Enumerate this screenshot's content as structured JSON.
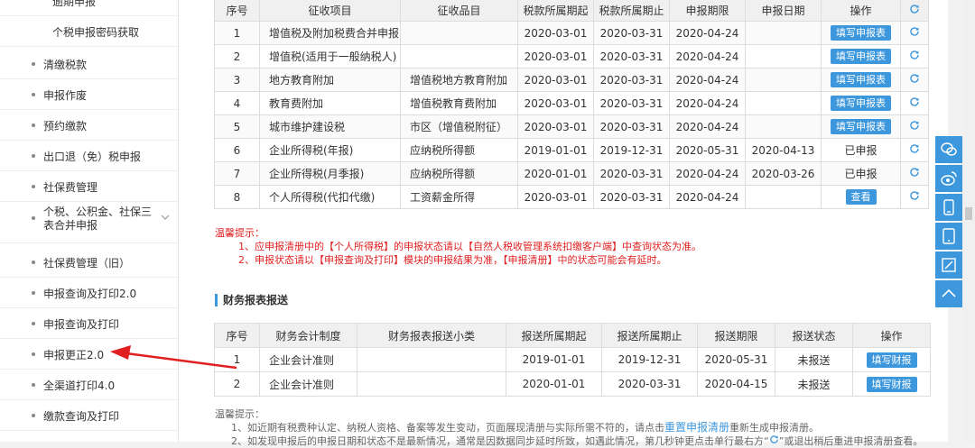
{
  "sidebar": {
    "items": [
      {
        "label": "逾期申报"
      },
      {
        "label": "个税申报密码获取"
      },
      {
        "label": "清缴税款"
      },
      {
        "label": "申报作废"
      },
      {
        "label": "预约缴款"
      },
      {
        "label": "出口退（免）税申报"
      },
      {
        "label": "社保费管理"
      },
      {
        "label": "个税、公积金、社保三表合并申报"
      },
      {
        "label": "社保费管理（旧）"
      },
      {
        "label": "申报查询及打印2.0"
      },
      {
        "label": "申报查询及打印"
      },
      {
        "label": "申报更正2.0"
      },
      {
        "label": "全渠道打印4.0"
      },
      {
        "label": "缴款查询及打印"
      }
    ]
  },
  "table1": {
    "headers": [
      "序号",
      "征收项目",
      "征收品目",
      "税款所属期起",
      "税款所属期止",
      "申报期限",
      "申报日期",
      "操作"
    ],
    "rows": [
      [
        "1",
        "增值税及附加税费合并申报",
        "",
        "2020-03-01",
        "2020-03-31",
        "2020-04-24",
        "",
        "填写申报表"
      ],
      [
        "2",
        "增值税(适用于一般纳税人)",
        "",
        "2020-03-01",
        "2020-03-31",
        "2020-04-24",
        "",
        "填写申报表"
      ],
      [
        "3",
        "地方教育附加",
        "增值税地方教育附加",
        "2020-03-01",
        "2020-03-31",
        "2020-04-24",
        "",
        "填写申报表"
      ],
      [
        "4",
        "教育费附加",
        "增值税教育费附加",
        "2020-03-01",
        "2020-03-31",
        "2020-04-24",
        "",
        "填写申报表"
      ],
      [
        "5",
        "城市维护建设税",
        "市区（增值税附征）",
        "2020-03-01",
        "2020-03-31",
        "2020-04-24",
        "",
        "填写申报表"
      ],
      [
        "6",
        "企业所得税(年报)",
        "应纳税所得额",
        "2019-01-01",
        "2019-12-31",
        "2020-05-31",
        "2020-04-13",
        "已申报"
      ],
      [
        "7",
        "企业所得税(月季报)",
        "应纳税所得额",
        "2020-01-01",
        "2020-03-31",
        "2020-04-24",
        "2020-03-26",
        "已申报"
      ],
      [
        "8",
        "个人所得税(代扣代缴)",
        "工资薪金所得",
        "2020-03-01",
        "2020-03-31",
        "2020-04-24",
        "",
        "查看"
      ]
    ]
  },
  "notice1": {
    "title": "温馨提示：",
    "line1": "1、应申报清册中的【个人所得税】的申报状态请以【自然人税收管理系统扣缴客户端】中查询状态为准。",
    "line2": "2、申报状态请以【申报查询及打印】模块的申报结果为准，【申报清册】中的状态可能会有延时。"
  },
  "section2_title": "财务报表报送",
  "table2": {
    "headers": [
      "序号",
      "财务会计制度",
      "财务报表报送小类",
      "报送所属期起",
      "报送所属期止",
      "报送期限",
      "报送状态",
      "操作"
    ],
    "rows": [
      [
        "1",
        "企业会计准则",
        "",
        "2019-01-01",
        "2019-12-31",
        "2020-05-31",
        "未报送",
        "填写财报"
      ],
      [
        "2",
        "企业会计准则",
        "",
        "2020-01-01",
        "2020-03-31",
        "2020-04-15",
        "未报送",
        "填写财报"
      ]
    ]
  },
  "notice2": {
    "title": "温馨提示：",
    "line1_a": "1、如近期有税费种认定、纳税人资格、备案等发生变动，页面展现清册与实际所需不符的，请点击",
    "line1_link": "重置申报清册",
    "line1_b": "重新生成申报清册。",
    "line2": "2、如发现申报后的申报日期和状态不是最新情况，通常是因数据同步延时所致，如遇此情况，第几秒钟更点击单行最右方“",
    "line2_b": "”或退出稍后重进申报清册查看。"
  },
  "colors": {
    "accent": "#3d97dc",
    "warning": "#e02020",
    "arrow": "#e02020"
  },
  "icons": {
    "refresh": "refresh-icon",
    "float": [
      "wechat-icon",
      "weibo-icon",
      "mobile-icon",
      "tablet-icon",
      "edit-icon",
      "back-to-top-icon"
    ]
  }
}
